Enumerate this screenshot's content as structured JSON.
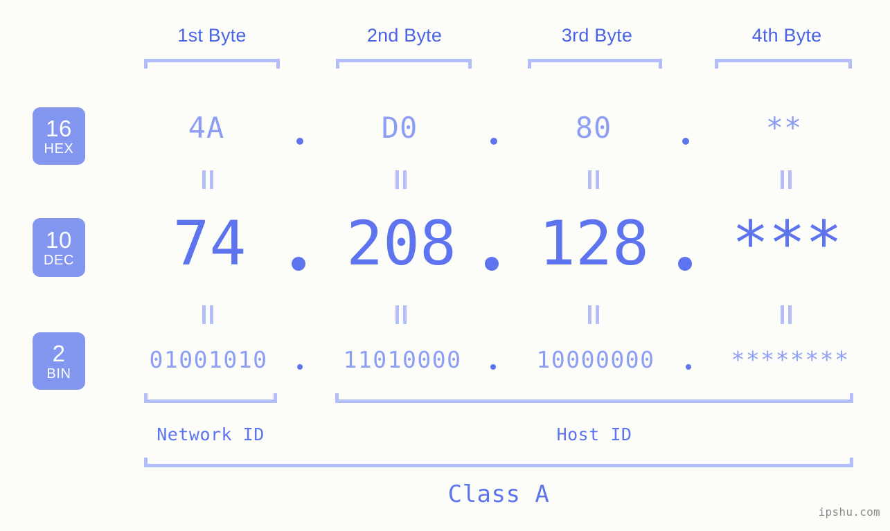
{
  "page": {
    "background_color": "#fcfdf9",
    "accent_color": "#5d74ee",
    "accent_light_color": "#8d9df4",
    "bracket_color": "#b3bdf7",
    "badge_color": "#8296f0",
    "watermark": "ipshu.com"
  },
  "byte_headers": [
    {
      "label": "1st Byte"
    },
    {
      "label": "2nd Byte"
    },
    {
      "label": "3rd Byte"
    },
    {
      "label": "4th Byte"
    }
  ],
  "rows": [
    {
      "base_number": "16",
      "base_name": "HEX",
      "values": [
        "4A",
        "D0",
        "80",
        "**"
      ],
      "separator": "."
    },
    {
      "base_number": "10",
      "base_name": "DEC",
      "values": [
        "74",
        "208",
        "128",
        "***"
      ],
      "separator": "."
    },
    {
      "base_number": "2",
      "base_name": "BIN",
      "values": [
        "01001010",
        "11010000",
        "10000000",
        "********"
      ],
      "separator": "."
    }
  ],
  "equality_marks": {
    "symbol": "||",
    "count_per_row": 4
  },
  "id_sections": [
    {
      "label": "Network ID"
    },
    {
      "label": "Host ID"
    }
  ],
  "class_section": {
    "label": "Class A"
  }
}
